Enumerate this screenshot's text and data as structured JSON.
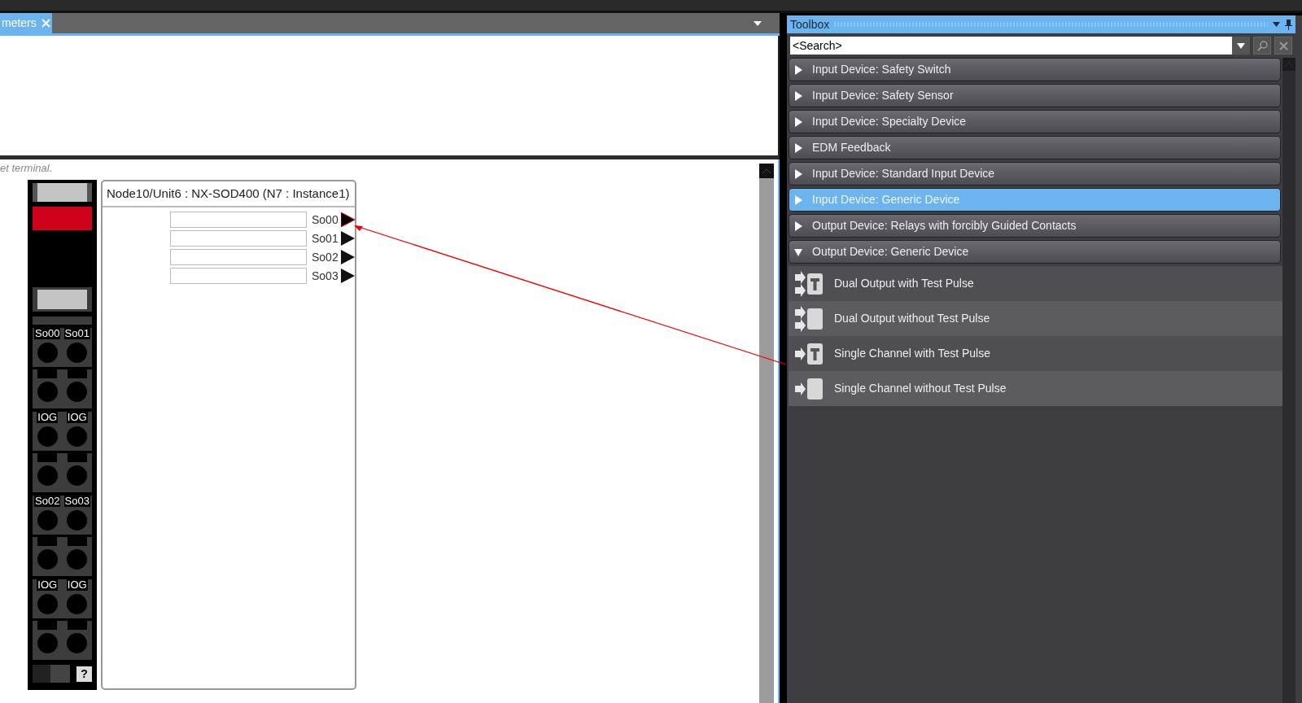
{
  "document_tab": {
    "label": "meters",
    "selected": true
  },
  "info_text": "et terminal.",
  "terminal_block": {
    "terminals": [
      [
        "So00",
        "So01"
      ],
      [
        "IOG",
        "IOG"
      ],
      [
        "So02",
        "So03"
      ],
      [
        "IOG",
        "IOG"
      ]
    ],
    "help": "?"
  },
  "module": {
    "title": "Node10/Unit6 : NX-SOD400 (N7 : Instance1)",
    "outputs": [
      {
        "label": "So00",
        "connected": true
      },
      {
        "label": "So01",
        "connected": false
      },
      {
        "label": "So02",
        "connected": false
      },
      {
        "label": "So03",
        "connected": false
      }
    ]
  },
  "toolbox": {
    "title": "Toolbox",
    "search": {
      "placeholder": "<Search>"
    },
    "categories": [
      {
        "label": "Input Device: Safety Switch",
        "selected": false,
        "expanded": false
      },
      {
        "label": "Input Device: Safety Sensor",
        "selected": false,
        "expanded": false
      },
      {
        "label": "Input Device: Specialty Device",
        "selected": false,
        "expanded": false
      },
      {
        "label": "EDM Feedback",
        "selected": false,
        "expanded": false
      },
      {
        "label": "Input Device: Standard Input Device",
        "selected": false,
        "expanded": false
      },
      {
        "label": "Input Device: Generic Device",
        "selected": true,
        "expanded": false
      },
      {
        "label": "Output Device: Relays with forcibly Guided Contacts",
        "selected": false,
        "expanded": false
      },
      {
        "label": "Output Device: Generic Device",
        "selected": false,
        "expanded": true,
        "children": [
          {
            "label": "Dual Output with Test Pulse",
            "kind": "dual",
            "test_pulse": true
          },
          {
            "label": "Dual Output without Test Pulse",
            "kind": "dual",
            "test_pulse": false
          },
          {
            "label": "Single Channel with Test Pulse",
            "kind": "single",
            "test_pulse": true
          },
          {
            "label": "Single Channel without Test Pulse",
            "kind": "single",
            "test_pulse": false
          }
        ]
      }
    ]
  }
}
